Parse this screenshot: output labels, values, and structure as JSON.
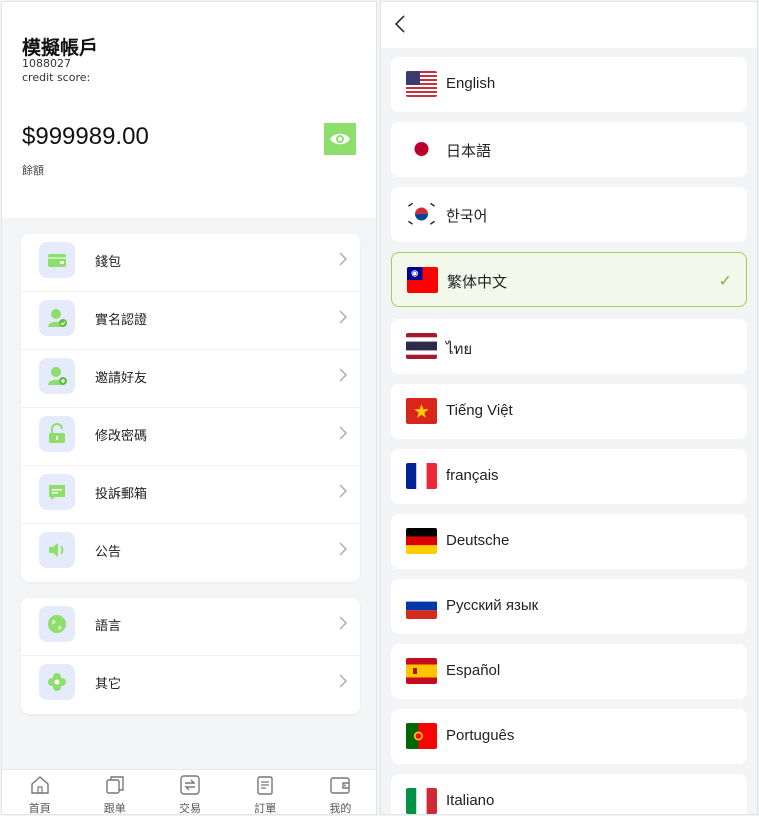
{
  "account": {
    "name": "模擬帳戶",
    "id": "1088027",
    "credit_label": "credit score:",
    "balance": "$999989.00",
    "balance_label": "餘額"
  },
  "menu": {
    "group1": [
      {
        "label": "錢包",
        "icon": "wallet-icon"
      },
      {
        "label": "實名認證",
        "icon": "user-verify-icon"
      },
      {
        "label": "邀請好友",
        "icon": "user-invite-icon"
      },
      {
        "label": "修改密碼",
        "icon": "lock-icon"
      },
      {
        "label": "投訴郵箱",
        "icon": "message-icon"
      },
      {
        "label": "公告",
        "icon": "speaker-icon"
      }
    ],
    "group2": [
      {
        "label": "語言",
        "icon": "globe-icon"
      },
      {
        "label": "其它",
        "icon": "flower-icon"
      }
    ]
  },
  "tabs": [
    {
      "label": "首頁",
      "icon": "home-icon"
    },
    {
      "label": "跟单",
      "icon": "copy-icon"
    },
    {
      "label": "交易",
      "icon": "exchange-icon"
    },
    {
      "label": "訂單",
      "icon": "order-icon"
    },
    {
      "label": "我的",
      "icon": "wallet-tab-icon"
    }
  ],
  "languages": [
    {
      "label": "English",
      "flag": "us-flag-icon"
    },
    {
      "label": "日本語",
      "flag": "jp-flag-icon"
    },
    {
      "label": "한국어",
      "flag": "kr-flag-icon"
    },
    {
      "label": "繁体中文",
      "flag": "tw-flag-icon",
      "selected": true
    },
    {
      "label": "ไทย",
      "flag": "th-flag-icon"
    },
    {
      "label": "Tiếng Việt",
      "flag": "vn-flag-icon"
    },
    {
      "label": "français",
      "flag": "fr-flag-icon"
    },
    {
      "label": "Deutsche",
      "flag": "de-flag-icon"
    },
    {
      "label": "Русский язык",
      "flag": "ru-flag-icon"
    },
    {
      "label": "Español",
      "flag": "es-flag-icon"
    },
    {
      "label": "Português",
      "flag": "pt-flag-icon"
    },
    {
      "label": "Italiano",
      "flag": "it-flag-icon"
    }
  ],
  "colors": {
    "accent_green": "#8ede6b",
    "selected_border": "#9bd159",
    "icon_bg": "#e5ebfa"
  },
  "check_mark": "✓"
}
